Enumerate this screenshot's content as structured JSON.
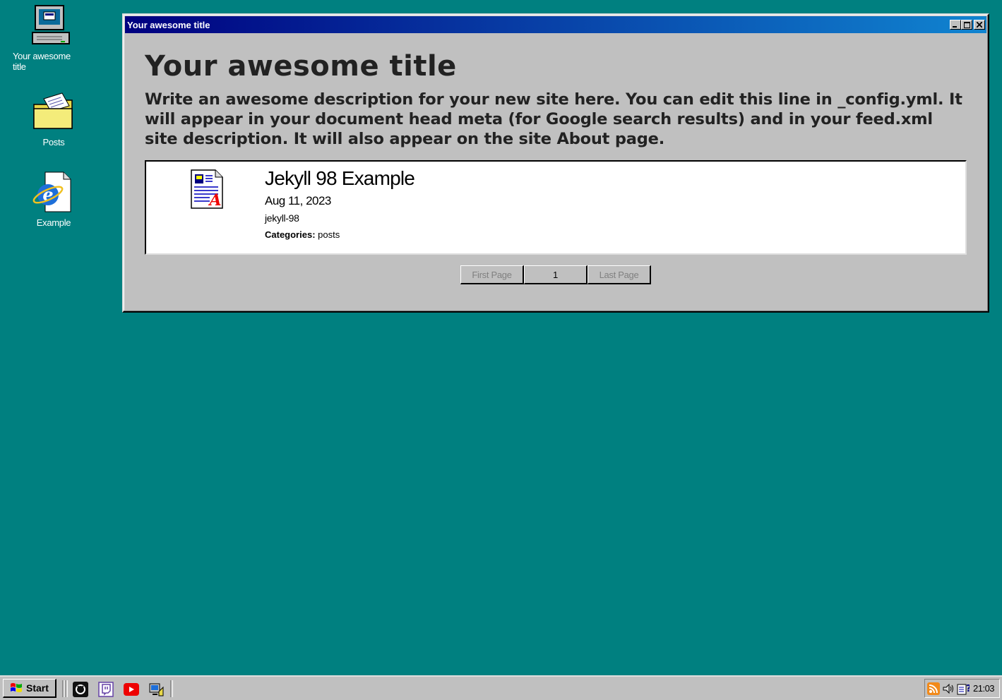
{
  "desktop": {
    "icons": [
      {
        "label": "Your awesome title",
        "icon": "my-computer-icon"
      },
      {
        "label": "Posts",
        "icon": "folder-icon"
      },
      {
        "label": "Example",
        "icon": "internet-explorer-icon"
      }
    ]
  },
  "window": {
    "title": "Your awesome title",
    "heading": "Your awesome title",
    "description": "Write an awesome description for your new site here. You can edit this line in _config.yml. It will appear in your document head meta (for Google search results) and in your feed.xml site description. It will also appear on the site About page.",
    "posts": [
      {
        "title": "Jekyll 98 Example",
        "date": "Aug 11, 2023",
        "slug": "jekyll-98",
        "categories_label": "Categories:",
        "categories": "posts",
        "icon": "document-icon"
      }
    ],
    "pager": {
      "first": "First Page",
      "current": "1",
      "last": "Last Page"
    }
  },
  "taskbar": {
    "start_label": "Start",
    "quick_launch": [
      "github-icon",
      "twitch-icon",
      "youtube-icon",
      "show-desktop-icon"
    ],
    "tray": {
      "icons": [
        "rss-icon",
        "volume-icon",
        "help-icon"
      ],
      "clock": "21:03"
    }
  }
}
